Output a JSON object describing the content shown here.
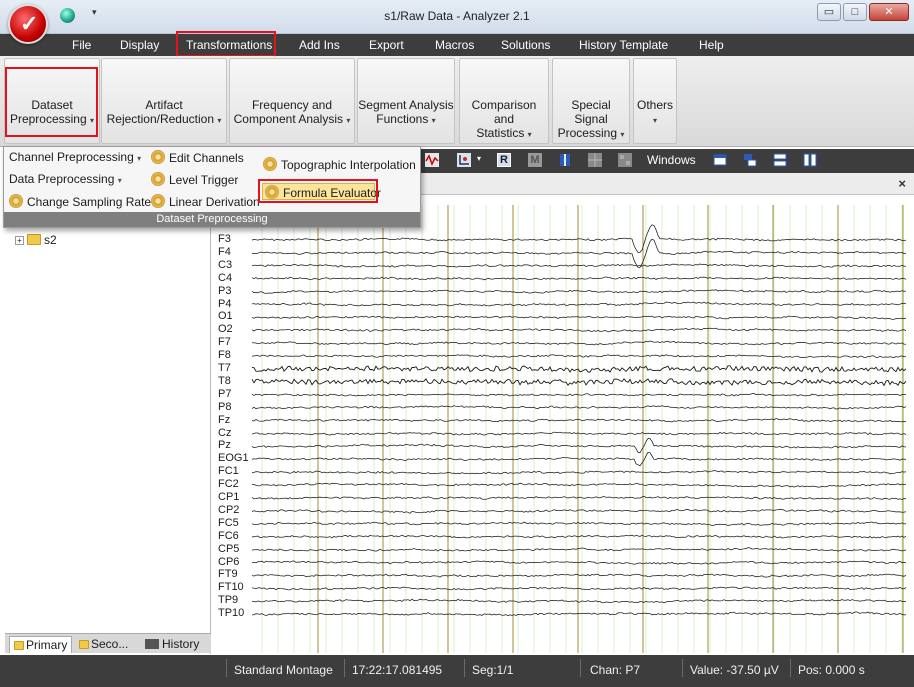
{
  "window": {
    "title": "s1/Raw Data - Analyzer 2.1",
    "min_glyph": "▭",
    "max_glyph": "□",
    "close_glyph": "✕"
  },
  "menu": [
    "File",
    "Display",
    "Transformations",
    "Add Ins",
    "Export",
    "Macros",
    "Solutions",
    "History Template",
    "Help"
  ],
  "ribbon": {
    "groups": [
      {
        "line1": "Dataset",
        "line2": "Preprocessing"
      },
      {
        "line1": "Artifact",
        "line2": "Rejection/Reduction"
      },
      {
        "line1": "Frequency and",
        "line2": "Component Analysis"
      },
      {
        "line1": "Segment Analysis",
        "line2": "Functions"
      },
      {
        "line1": "Comparison and",
        "line2": "Statistics"
      },
      {
        "line1": "Special Signal",
        "line2": "Processing"
      },
      {
        "line1": "Others",
        "line2": ""
      }
    ],
    "dropdown_glyph": "▾"
  },
  "dataset_menu": {
    "channel_preprocessing": "Channel Preprocessing",
    "data_preprocessing": "Data Preprocessing",
    "change_sampling_rate": "Change Sampling Rate",
    "edit_channels": "Edit Channels",
    "level_trigger": "Level Trigger",
    "linear_derivation": "Linear Derivation",
    "topographic_interpolation": "Topographic Interpolation",
    "formula_evaluator": "Formula Evaluator",
    "group_label": "Dataset Preprocessing",
    "caret": "▾"
  },
  "tree": {
    "node": "s2",
    "expander": "+"
  },
  "panel_tabs": [
    "Primary",
    "Seco...",
    "History"
  ],
  "toolbar": {
    "windows_label": "Windows",
    "r_glyph": "R",
    "m_glyph": "M"
  },
  "chart_close": "×",
  "channels": [
    "F3",
    "F4",
    "C3",
    "C4",
    "P3",
    "P4",
    "O1",
    "O2",
    "F7",
    "F8",
    "T7",
    "T8",
    "P7",
    "P8",
    "Fz",
    "Cz",
    "Pz",
    "EOG1",
    "FC1",
    "FC2",
    "CP1",
    "CP2",
    "FC5",
    "FC6",
    "CP5",
    "CP6",
    "FT9",
    "FT10",
    "TP9",
    "TP10"
  ],
  "status": {
    "montage": "Standard Montage",
    "time": "17:22:17.081495",
    "segment": "Seg:1/1",
    "channel": "Chan:  P7",
    "value": "Value: -37.50 µV",
    "position": "Pos:  0.000 s"
  },
  "colors": {
    "dark_bar": "#3d3d3d",
    "highlight_red": "#e0141a",
    "grid_green": "#b8e6a6",
    "marker_olive": "#a08c3a"
  }
}
